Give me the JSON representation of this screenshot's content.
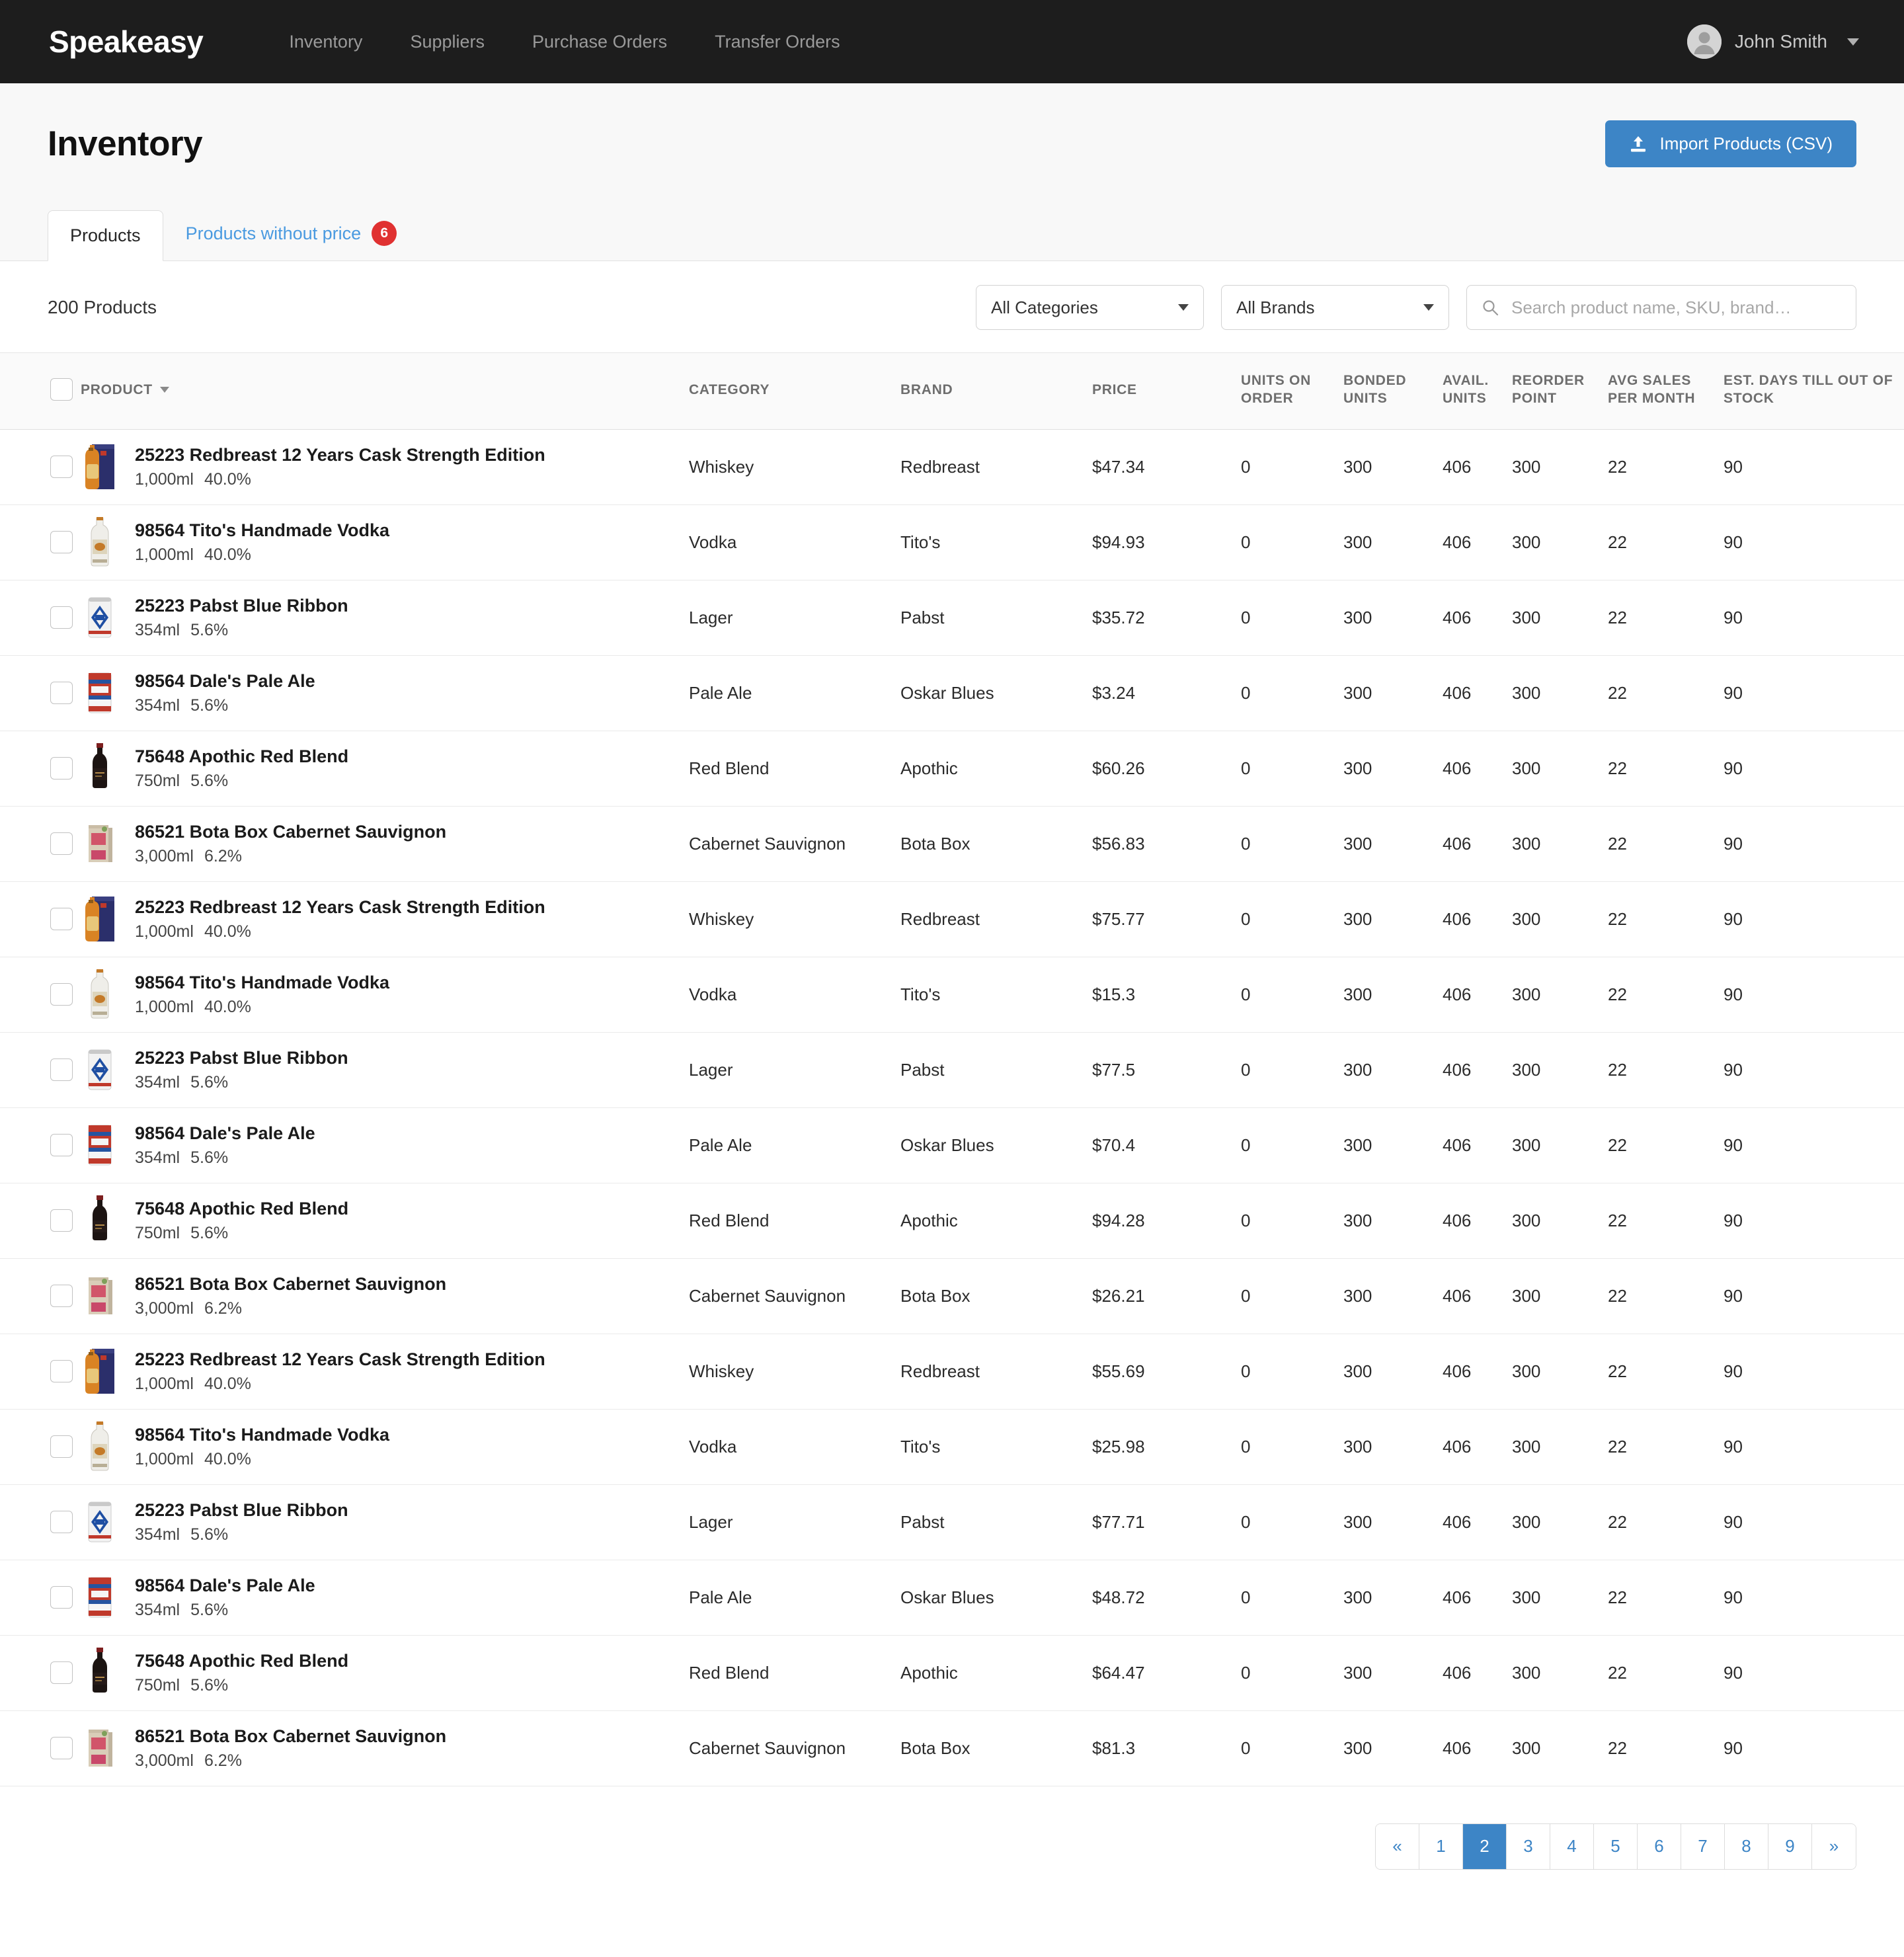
{
  "navbar": {
    "brand": "Speakeasy",
    "links": [
      {
        "label": "Inventory"
      },
      {
        "label": "Suppliers"
      },
      {
        "label": "Purchase Orders"
      },
      {
        "label": "Transfer Orders"
      }
    ],
    "user": {
      "name": "John Smith",
      "avatar_icon": "user-avatar-icon",
      "caret_icon": "chevron-down-icon"
    }
  },
  "header": {
    "title": "Inventory",
    "import_button": {
      "label": "Import Products (CSV)",
      "icon": "upload-icon"
    }
  },
  "tabs": [
    {
      "label": "Products",
      "active": true,
      "badge": null
    },
    {
      "label": "Products without price",
      "active": false,
      "badge": "6"
    }
  ],
  "toolbar": {
    "product_count": "200 Products",
    "category_select": {
      "value": "All Categories",
      "icon": "chevron-down-icon"
    },
    "brand_select": {
      "value": "All Brands",
      "icon": "chevron-down-icon"
    },
    "search": {
      "value": "",
      "placeholder": "Search product name, SKU, brand…",
      "icon": "search-icon"
    }
  },
  "table": {
    "headers": {
      "product": "PRODUCT",
      "category": "CATEGORY",
      "brand": "BRAND",
      "price": "PRICE",
      "units_on_order": "UNITS ON ORDER",
      "bonded_units": "BONDED UNITS",
      "avail_units": "AVAIL. UNITS",
      "reorder_point": "REORDER POINT",
      "avg_sales_per_month": "AVG SALES PER MONTH",
      "est_days_till_out_of_stock": "EST. DAYS TILL OUT OF STOCK"
    },
    "rows": [
      {
        "sku": "25223",
        "name": "Redbreast 12 Years Cask Strength Edition",
        "volume": "1,000ml",
        "abv": "40.0%",
        "category": "Whiskey",
        "brand": "Redbreast",
        "price": "$47.34",
        "units_on_order": "0",
        "bonded_units": "300",
        "avail_units": "406",
        "reorder_point": "300",
        "avg_sales": "22",
        "est_days": "90",
        "thumb": "redbreast-box"
      },
      {
        "sku": "98564",
        "name": "Tito's Handmade Vodka",
        "volume": "1,000ml",
        "abv": "40.0%",
        "category": "Vodka",
        "brand": "Tito's",
        "price": "$94.93",
        "units_on_order": "0",
        "bonded_units": "300",
        "avail_units": "406",
        "reorder_point": "300",
        "avg_sales": "22",
        "est_days": "90",
        "thumb": "titos-bottle"
      },
      {
        "sku": "25223",
        "name": "Pabst Blue Ribbon",
        "volume": "354ml",
        "abv": "5.6%",
        "category": "Lager",
        "brand": "Pabst",
        "price": "$35.72",
        "units_on_order": "0",
        "bonded_units": "300",
        "avail_units": "406",
        "reorder_point": "300",
        "avg_sales": "22",
        "est_days": "90",
        "thumb": "pabst-can"
      },
      {
        "sku": "98564",
        "name": "Dale's Pale Ale",
        "volume": "354ml",
        "abv": "5.6%",
        "category": "Pale Ale",
        "brand": "Oskar Blues",
        "price": "$3.24",
        "units_on_order": "0",
        "bonded_units": "300",
        "avail_units": "406",
        "reorder_point": "300",
        "avg_sales": "22",
        "est_days": "90",
        "thumb": "dales-can"
      },
      {
        "sku": "75648",
        "name": "Apothic Red Blend",
        "volume": "750ml",
        "abv": "5.6%",
        "category": "Red Blend",
        "brand": "Apothic",
        "price": "$60.26",
        "units_on_order": "0",
        "bonded_units": "300",
        "avail_units": "406",
        "reorder_point": "300",
        "avg_sales": "22",
        "est_days": "90",
        "thumb": "apothic-bottle"
      },
      {
        "sku": "86521",
        "name": "Bota Box Cabernet Sauvignon",
        "volume": "3,000ml",
        "abv": "6.2%",
        "category": "Cabernet Sauvignon",
        "brand": "Bota Box",
        "price": "$56.83",
        "units_on_order": "0",
        "bonded_units": "300",
        "avail_units": "406",
        "reorder_point": "300",
        "avg_sales": "22",
        "est_days": "90",
        "thumb": "botabox-box"
      },
      {
        "sku": "25223",
        "name": "Redbreast 12 Years Cask Strength Edition",
        "volume": "1,000ml",
        "abv": "40.0%",
        "category": "Whiskey",
        "brand": "Redbreast",
        "price": "$75.77",
        "units_on_order": "0",
        "bonded_units": "300",
        "avail_units": "406",
        "reorder_point": "300",
        "avg_sales": "22",
        "est_days": "90",
        "thumb": "redbreast-box"
      },
      {
        "sku": "98564",
        "name": "Tito's Handmade Vodka",
        "volume": "1,000ml",
        "abv": "40.0%",
        "category": "Vodka",
        "brand": "Tito's",
        "price": "$15.3",
        "units_on_order": "0",
        "bonded_units": "300",
        "avail_units": "406",
        "reorder_point": "300",
        "avg_sales": "22",
        "est_days": "90",
        "thumb": "titos-bottle"
      },
      {
        "sku": "25223",
        "name": "Pabst Blue Ribbon",
        "volume": "354ml",
        "abv": "5.6%",
        "category": "Lager",
        "brand": "Pabst",
        "price": "$77.5",
        "units_on_order": "0",
        "bonded_units": "300",
        "avail_units": "406",
        "reorder_point": "300",
        "avg_sales": "22",
        "est_days": "90",
        "thumb": "pabst-can"
      },
      {
        "sku": "98564",
        "name": "Dale's Pale Ale",
        "volume": "354ml",
        "abv": "5.6%",
        "category": "Pale Ale",
        "brand": "Oskar Blues",
        "price": "$70.4",
        "units_on_order": "0",
        "bonded_units": "300",
        "avail_units": "406",
        "reorder_point": "300",
        "avg_sales": "22",
        "est_days": "90",
        "thumb": "dales-can"
      },
      {
        "sku": "75648",
        "name": "Apothic Red Blend",
        "volume": "750ml",
        "abv": "5.6%",
        "category": "Red Blend",
        "brand": "Apothic",
        "price": "$94.28",
        "units_on_order": "0",
        "bonded_units": "300",
        "avail_units": "406",
        "reorder_point": "300",
        "avg_sales": "22",
        "est_days": "90",
        "thumb": "apothic-bottle"
      },
      {
        "sku": "86521",
        "name": "Bota Box Cabernet Sauvignon",
        "volume": "3,000ml",
        "abv": "6.2%",
        "category": "Cabernet Sauvignon",
        "brand": "Bota Box",
        "price": "$26.21",
        "units_on_order": "0",
        "bonded_units": "300",
        "avail_units": "406",
        "reorder_point": "300",
        "avg_sales": "22",
        "est_days": "90",
        "thumb": "botabox-box"
      },
      {
        "sku": "25223",
        "name": "Redbreast 12 Years Cask Strength Edition",
        "volume": "1,000ml",
        "abv": "40.0%",
        "category": "Whiskey",
        "brand": "Redbreast",
        "price": "$55.69",
        "units_on_order": "0",
        "bonded_units": "300",
        "avail_units": "406",
        "reorder_point": "300",
        "avg_sales": "22",
        "est_days": "90",
        "thumb": "redbreast-box"
      },
      {
        "sku": "98564",
        "name": "Tito's Handmade Vodka",
        "volume": "1,000ml",
        "abv": "40.0%",
        "category": "Vodka",
        "brand": "Tito's",
        "price": "$25.98",
        "units_on_order": "0",
        "bonded_units": "300",
        "avail_units": "406",
        "reorder_point": "300",
        "avg_sales": "22",
        "est_days": "90",
        "thumb": "titos-bottle"
      },
      {
        "sku": "25223",
        "name": "Pabst Blue Ribbon",
        "volume": "354ml",
        "abv": "5.6%",
        "category": "Lager",
        "brand": "Pabst",
        "price": "$77.71",
        "units_on_order": "0",
        "bonded_units": "300",
        "avail_units": "406",
        "reorder_point": "300",
        "avg_sales": "22",
        "est_days": "90",
        "thumb": "pabst-can"
      },
      {
        "sku": "98564",
        "name": "Dale's Pale Ale",
        "volume": "354ml",
        "abv": "5.6%",
        "category": "Pale Ale",
        "brand": "Oskar Blues",
        "price": "$48.72",
        "units_on_order": "0",
        "bonded_units": "300",
        "avail_units": "406",
        "reorder_point": "300",
        "avg_sales": "22",
        "est_days": "90",
        "thumb": "dales-can"
      },
      {
        "sku": "75648",
        "name": "Apothic Red Blend",
        "volume": "750ml",
        "abv": "5.6%",
        "category": "Red Blend",
        "brand": "Apothic",
        "price": "$64.47",
        "units_on_order": "0",
        "bonded_units": "300",
        "avail_units": "406",
        "reorder_point": "300",
        "avg_sales": "22",
        "est_days": "90",
        "thumb": "apothic-bottle"
      },
      {
        "sku": "86521",
        "name": "Bota Box Cabernet Sauvignon",
        "volume": "3,000ml",
        "abv": "6.2%",
        "category": "Cabernet Sauvignon",
        "brand": "Bota Box",
        "price": "$81.3",
        "units_on_order": "0",
        "bonded_units": "300",
        "avail_units": "406",
        "reorder_point": "300",
        "avg_sales": "22",
        "est_days": "90",
        "thumb": "botabox-box"
      }
    ]
  },
  "pagination": {
    "prev": "«",
    "next": "»",
    "pages": [
      "1",
      "2",
      "3",
      "4",
      "5",
      "6",
      "7",
      "8",
      "9"
    ],
    "current": "2"
  },
  "colors": {
    "accent_blue": "#3d85c6",
    "badge_red": "#e03131",
    "navbar_bg": "#1d1d1d"
  }
}
